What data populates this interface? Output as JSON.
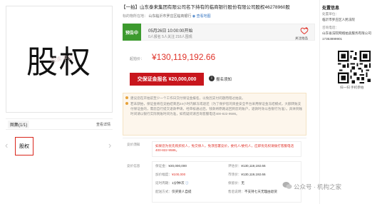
{
  "gallery": {
    "hero_text": "股权",
    "watermark": "拍卖平台",
    "counter": "图集(1/1)",
    "detail_link": "查看详情",
    "thumb_text": "股权",
    "prev_icon": "chevron-left-icon",
    "next_icon": "chevron-right-icon"
  },
  "header": {
    "title": "【一拍】山东泰来集团有限公司名下持有的临商银行股份有限公司股权46278960股",
    "location_label": "标的物所在地：",
    "location_value": "山东临沂市罗庄区临商银行",
    "map_link": "查看地图"
  },
  "status": {
    "badge": "预告中",
    "time": "05月26日 10:00:00开始",
    "stats": "0人报名  5人关注  216人围观",
    "fav_label": "关注拍品"
  },
  "price": {
    "label": "起拍价：",
    "value": "¥130,119,192.66"
  },
  "actions": {
    "deposit_button": "交保证金报名 ¥20,000,000",
    "notice_label": "报名须知"
  },
  "notes": [
    "建议您在开拍前至少一个工作日交付保证金报名，以免因支付问题而错过拍卖。",
    "若未获拍，保证金将在竞拍结束后24小时内解冻或退还（为了保护您的资金安全平台采用保证金冻结模式，大额转账支付保证金的，需您自行提交退款申请，经审核通过后，钱款将原路返回到您的账户，退款时效以各银行为准）。具体到账时间请以银行实际到账时间为准，如有疑问请咨询客服电话400-822-9586。"
  ],
  "guide": {
    "label": "竞价须知",
    "text": "如果您为优先购买权人，免交保人，免须签署竞价，委托人/委托人，应即优先权请拨打客服电话400-822-9586。"
  },
  "info": {
    "section_label": "竞价信息",
    "rows": [
      {
        "l": "保证金：",
        "v": "¥20,000,000",
        "l2": "评估价：",
        "v2": "¥130,119,192.66"
      },
      {
        "l": "加价幅度：",
        "v": "¥100,000",
        "l2": "市场价：",
        "v2": "¥130,119,192.66"
      },
      {
        "l": "延时周期：",
        "v": "1分钟/次",
        "l2": "保留价：",
        "v2": "无"
      },
      {
        "l": "配送方式：",
        "v": "仅买受人自提",
        "l2": "售后说明：",
        "v2": "不支持七天无理由退货"
      }
    ]
  },
  "disposal": {
    "title": "处置信息",
    "unit_label": "处置单位：",
    "unit_value": "临沂市罗庄区人民法院",
    "contact_label": "咨询电话：",
    "contact_value": "山东省法院网络拍卖服务有限公司",
    "phone": "17353899901",
    "qr_label": "扫一扫 手机参拍"
  },
  "watermark": {
    "text": "公众号 · 机构之家"
  }
}
